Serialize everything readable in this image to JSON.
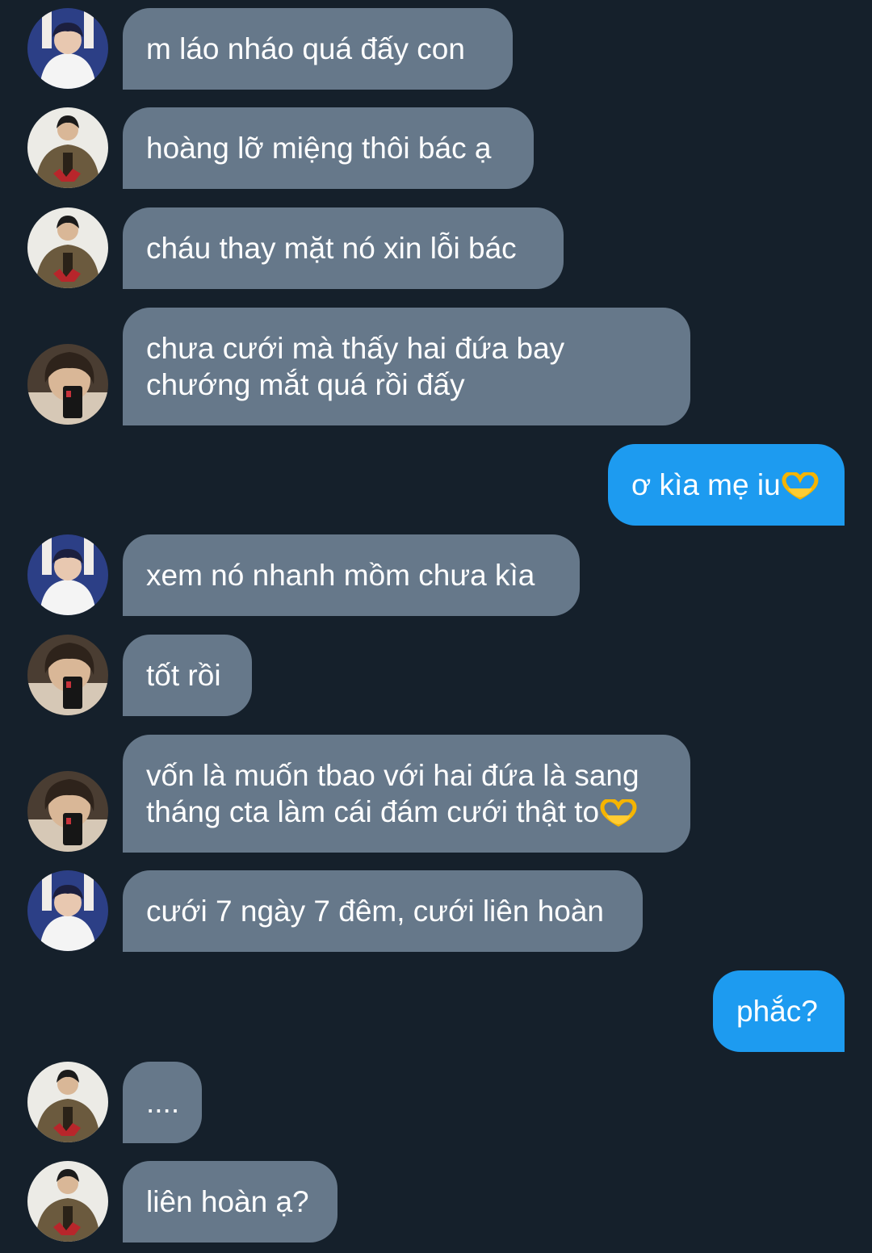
{
  "avatars": {
    "a": "avatar-white-shirt-person",
    "b": "avatar-brown-jacket-person",
    "c": "avatar-mirror-selfie-person"
  },
  "colors": {
    "background": "#15202b",
    "incoming_bubble": "#66788a",
    "outgoing_bubble": "#1d9bf0",
    "text": "#ffffff"
  },
  "messages": [
    {
      "side": "in",
      "avatar": "a",
      "lines": [
        "m láo nháo quá đấy con"
      ]
    },
    {
      "side": "in",
      "avatar": "b",
      "lines": [
        "hoàng lỡ miệng thôi bác ạ"
      ]
    },
    {
      "side": "in",
      "avatar": "b",
      "lines": [
        "cháu thay mặt nó xin lỗi bác"
      ]
    },
    {
      "side": "in",
      "avatar": "c",
      "lines": [
        "chưa cưới mà thấy hai đứa bay",
        "chướng mắt quá rồi đấy"
      ]
    },
    {
      "side": "out",
      "lines": [
        "ơ kìa mẹ iu"
      ],
      "emoji": "heart-hands-icon"
    },
    {
      "side": "in",
      "avatar": "a",
      "lines": [
        "xem nó nhanh mồm chưa kìa"
      ]
    },
    {
      "side": "in",
      "avatar": "c",
      "lines": [
        "tốt rồi"
      ]
    },
    {
      "side": "in",
      "avatar": "c",
      "lines": [
        "vốn là muốn tbao với hai đứa là sang",
        "tháng cta làm cái đám cưới thật to"
      ],
      "emoji": "heart-hands-icon"
    },
    {
      "side": "in",
      "avatar": "a",
      "lines": [
        "cưới 7 ngày 7 đêm, cưới liên hoàn"
      ]
    },
    {
      "side": "out",
      "lines": [
        "phắc?"
      ]
    },
    {
      "side": "in",
      "avatar": "b",
      "lines": [
        "...."
      ]
    },
    {
      "side": "in",
      "avatar": "b",
      "lines": [
        "liên hoàn ạ?"
      ]
    }
  ]
}
